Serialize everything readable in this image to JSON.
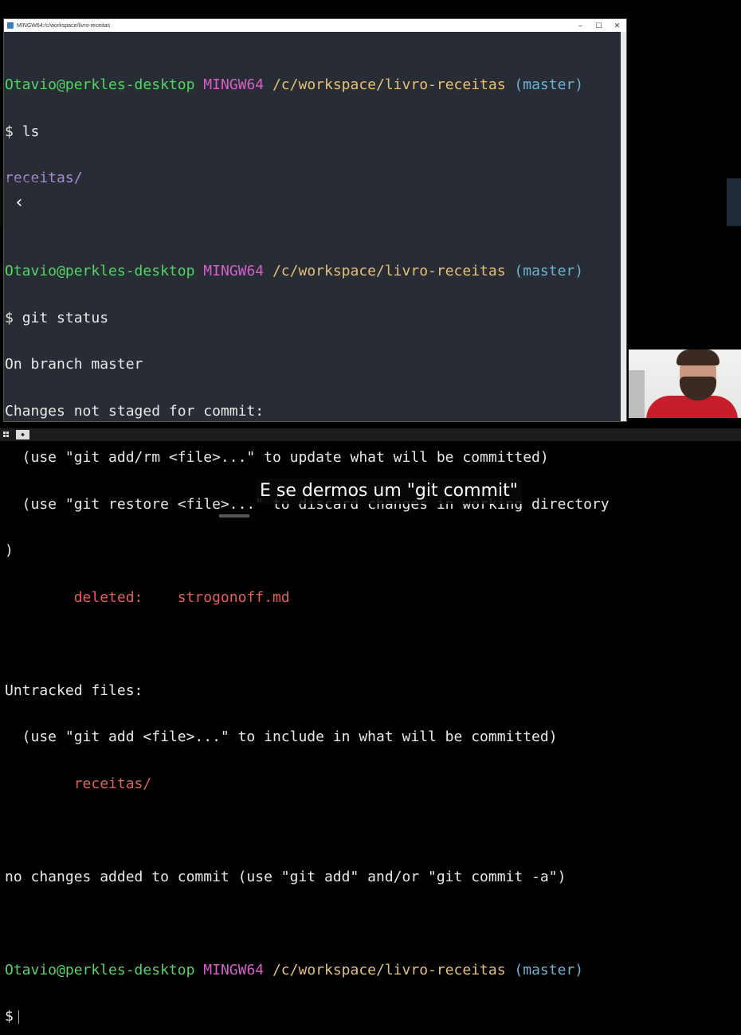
{
  "window": {
    "title": "MINGW64:/c/workspace/livro-receitas",
    "minimize": "–",
    "maximize": "☐",
    "close": "✕"
  },
  "prompt": {
    "user": "Otavio@perkles-desktop",
    "env": "MINGW64",
    "path": "/c/workspace/livro-receitas",
    "branch": "(master)",
    "symbol": "$"
  },
  "terminal": {
    "cmd1": "ls",
    "ls_out": "receitas/",
    "cmd2": "git status",
    "l_branch": "On branch master",
    "l_changes": "Changes not staged for commit:",
    "l_hint1": "  (use \"git add/rm <file>...\" to update what will be committed)",
    "l_hint2": "  (use \"git restore <file>...\" to discard changes in working directory",
    "l_paren": ")",
    "deleted_label": "        deleted:    ",
    "deleted_file": "strogonoff.md",
    "l_untracked": "Untracked files:",
    "l_hint3": "  (use \"git add <file>...\" to include in what will be committed)",
    "untracked_file": "        receitas/",
    "l_nochanges": "no changes added to commit (use \"git add\" and/or \"git commit -a\")"
  },
  "nav": {
    "prev_icon": "‹"
  },
  "subtitle": "E se dermos um \"git commit\""
}
